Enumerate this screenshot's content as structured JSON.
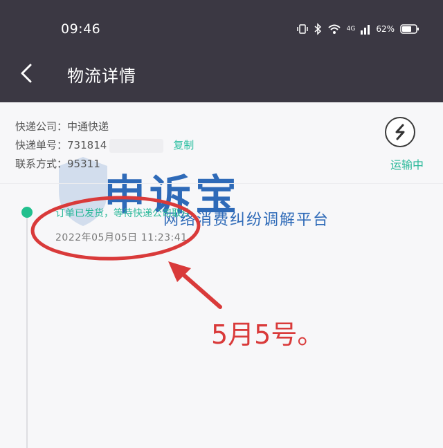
{
  "status_bar": {
    "time": "09:46",
    "signal_label": "4G",
    "battery_percent": "62%"
  },
  "nav": {
    "title": "物流详情"
  },
  "shipment": {
    "company_label": "快递公司：",
    "company": "中通快递",
    "number_label": "快递单号：",
    "number_visible": "731814",
    "copy_label": "复制",
    "contact_label": "联系方式：",
    "contact": "95311",
    "status": "运输中"
  },
  "timeline": [
    {
      "text": "订单已发货，等待快递公司取件",
      "time": "2022年05月05日 11:23:41"
    }
  ],
  "watermark": {
    "main": "申诉宝",
    "sub": "网络消费纠纷调解平台"
  },
  "annotation": {
    "text": "5月5号。",
    "color": "#d93a3a"
  },
  "colors": {
    "header_bg": "#3b3843",
    "accent_green": "#22c08e"
  }
}
